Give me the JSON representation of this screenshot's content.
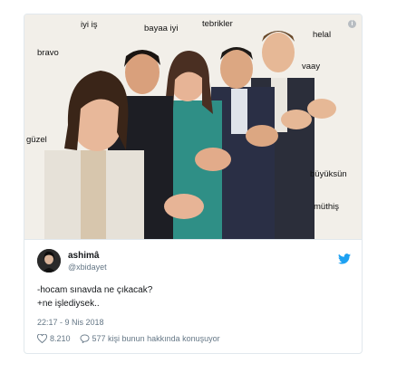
{
  "captions": {
    "iyi_is": "iyi iş",
    "bayaa_iyi": "bayaa iyi",
    "tebrikler": "tebrikler",
    "helal": "helal",
    "bravo": "bravo",
    "vaay": "vaay",
    "guzel": "güzel",
    "buyuksun": "büyüksün",
    "muthis": "müthiş"
  },
  "tweet": {
    "display_name": "ashimâ",
    "handle": "@xbidayet",
    "line1": "-hocam sınavda ne çıkacak?",
    "line2": "+ne işlediysek..",
    "timestamp": "22:17 - 9 Nis 2018",
    "likes": "8.210",
    "replies_text": "577 kişi bunun hakkında konuşuyor"
  },
  "icons": {
    "info": "info-icon",
    "bird": "twitter-bird-icon",
    "heart": "heart-icon",
    "reply": "reply-bubble-icon"
  },
  "colors": {
    "twitter_blue": "#1da1f2",
    "meta_gray": "#657786"
  }
}
